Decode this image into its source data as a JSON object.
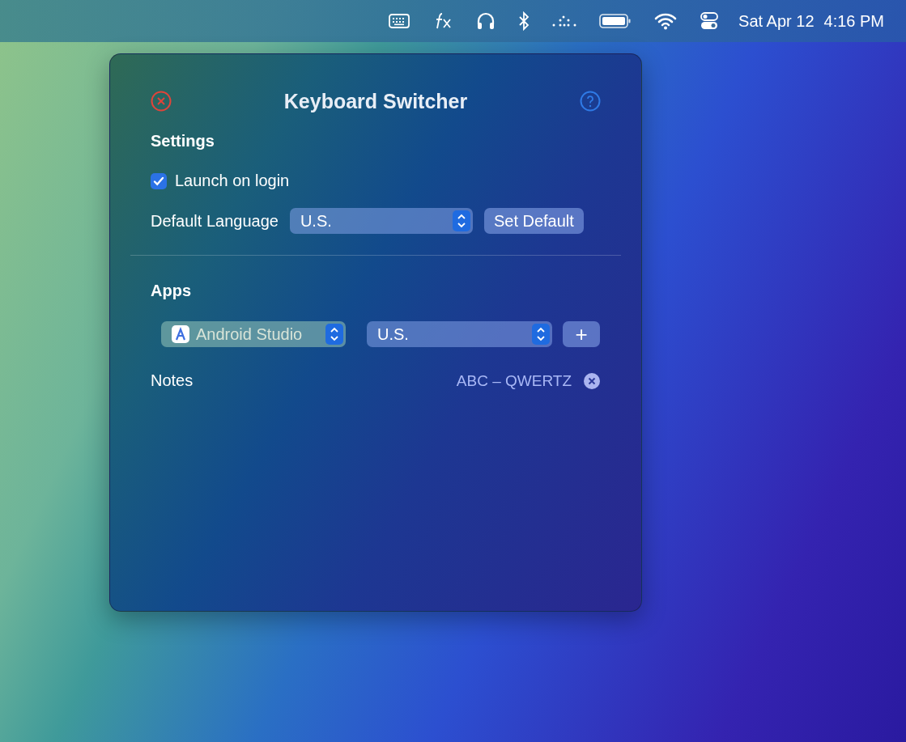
{
  "menu_bar": {
    "date": "Sat Apr 12",
    "time": "4:16 PM"
  },
  "popover": {
    "title": "Keyboard Switcher",
    "settings": {
      "heading": "Settings",
      "launch_on_login": {
        "label": "Launch on login",
        "checked": true
      },
      "default_language": {
        "label": "Default Language",
        "value": "U.S.",
        "button": "Set Default"
      }
    },
    "apps": {
      "heading": "Apps",
      "rows": [
        {
          "app": "Android Studio",
          "language": "U.S.",
          "add_button": "+"
        }
      ]
    },
    "notes": {
      "label": "Notes",
      "value": "ABC – QWERTZ"
    }
  }
}
